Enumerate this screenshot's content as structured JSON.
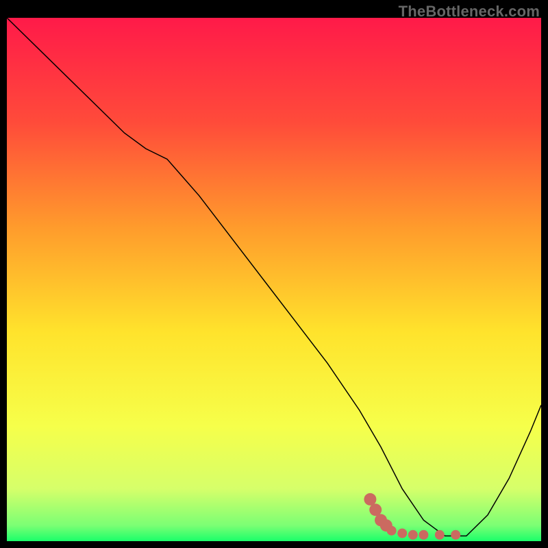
{
  "watermark": "TheBottleneck.com",
  "chart_data": {
    "type": "line",
    "title": "",
    "xlabel": "",
    "ylabel": "",
    "xlim": [
      0,
      100
    ],
    "ylim": [
      0,
      100
    ],
    "grid": false,
    "legend": false,
    "background_gradient": {
      "stops": [
        {
          "pos": 0.0,
          "color": "#ff1a49"
        },
        {
          "pos": 0.2,
          "color": "#ff4b3a"
        },
        {
          "pos": 0.4,
          "color": "#ff9b2c"
        },
        {
          "pos": 0.6,
          "color": "#ffe32c"
        },
        {
          "pos": 0.78,
          "color": "#f6ff4a"
        },
        {
          "pos": 0.9,
          "color": "#d6ff6a"
        },
        {
          "pos": 0.97,
          "color": "#7bff74"
        },
        {
          "pos": 1.0,
          "color": "#1aff6a"
        }
      ]
    },
    "series": [
      {
        "name": "curve",
        "color": "#000000",
        "width": 1.5,
        "x": [
          0,
          6,
          12,
          18,
          22,
          26,
          30,
          36,
          42,
          48,
          54,
          60,
          66,
          70,
          74,
          78,
          82,
          86,
          90,
          94,
          98,
          100
        ],
        "y": [
          100,
          94,
          88,
          82,
          78,
          75,
          73,
          66,
          58,
          50,
          42,
          34,
          25,
          18,
          10,
          4,
          1,
          1,
          5,
          12,
          21,
          26
        ]
      }
    ],
    "markers": {
      "name": "band",
      "color": "#cb6a60",
      "points": [
        {
          "x": 68,
          "y": 8
        },
        {
          "x": 69,
          "y": 6
        },
        {
          "x": 70,
          "y": 4
        },
        {
          "x": 71,
          "y": 3
        },
        {
          "x": 72,
          "y": 2
        },
        {
          "x": 74,
          "y": 1.5
        },
        {
          "x": 76,
          "y": 1.2
        },
        {
          "x": 78,
          "y": 1.2
        },
        {
          "x": 81,
          "y": 1.2
        },
        {
          "x": 84,
          "y": 1.2
        }
      ]
    }
  }
}
